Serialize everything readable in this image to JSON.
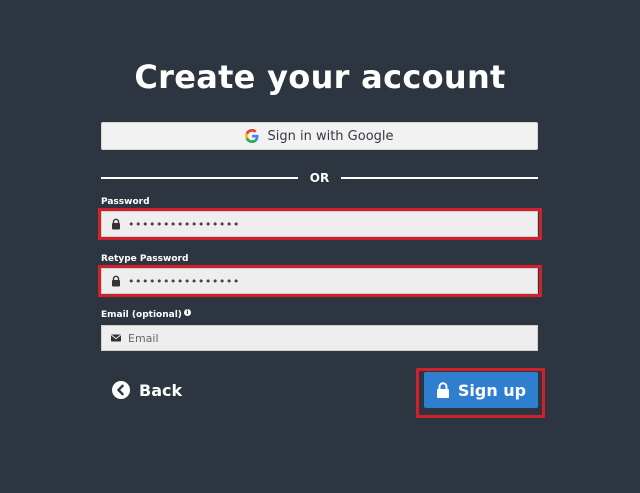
{
  "page": {
    "title": "Create your account"
  },
  "google": {
    "label": "Sign in with Google",
    "icon": "google-icon"
  },
  "divider": {
    "text": "OR"
  },
  "password": {
    "label": "Password",
    "value": "••••••••••••••••",
    "icon": "lock-icon"
  },
  "retype_password": {
    "label": "Retype Password",
    "value": "••••••••••••••••",
    "icon": "lock-icon"
  },
  "email": {
    "label": "Email (optional)",
    "info_icon": "info-icon",
    "placeholder": "Email",
    "icon": "envelope-icon"
  },
  "actions": {
    "back_label": "Back",
    "back_icon": "chevron-left-circle-icon",
    "signup_label": "Sign up",
    "signup_icon": "lock-icon"
  },
  "colors": {
    "background": "#2d3640",
    "primary": "#2f7fd0",
    "highlight": "#d0202a",
    "field_bg": "#eeeeee"
  }
}
